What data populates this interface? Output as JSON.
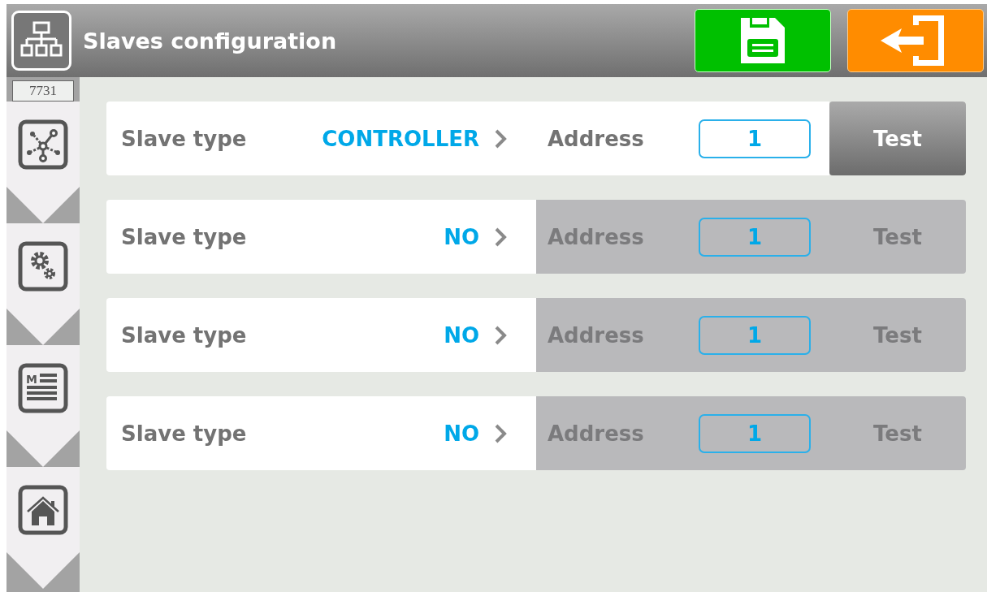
{
  "header": {
    "title": "Slaves configuration"
  },
  "sidebar": {
    "badge": "7731",
    "items": [
      {
        "kind": "network"
      },
      {
        "kind": "settings"
      },
      {
        "kind": "manual",
        "letter": "M"
      },
      {
        "kind": "home"
      }
    ]
  },
  "rows": [
    {
      "label": "Slave type",
      "value": "CONTROLLER",
      "address_label": "Address",
      "address": "1",
      "test": "Test",
      "enabled": true
    },
    {
      "label": "Slave type",
      "value": "NO",
      "address_label": "Address",
      "address": "1",
      "test": "Test",
      "enabled": false
    },
    {
      "label": "Slave type",
      "value": "NO",
      "address_label": "Address",
      "address": "1",
      "test": "Test",
      "enabled": false
    },
    {
      "label": "Slave type",
      "value": "NO",
      "address_label": "Address",
      "address": "1",
      "test": "Test",
      "enabled": false
    }
  ]
}
